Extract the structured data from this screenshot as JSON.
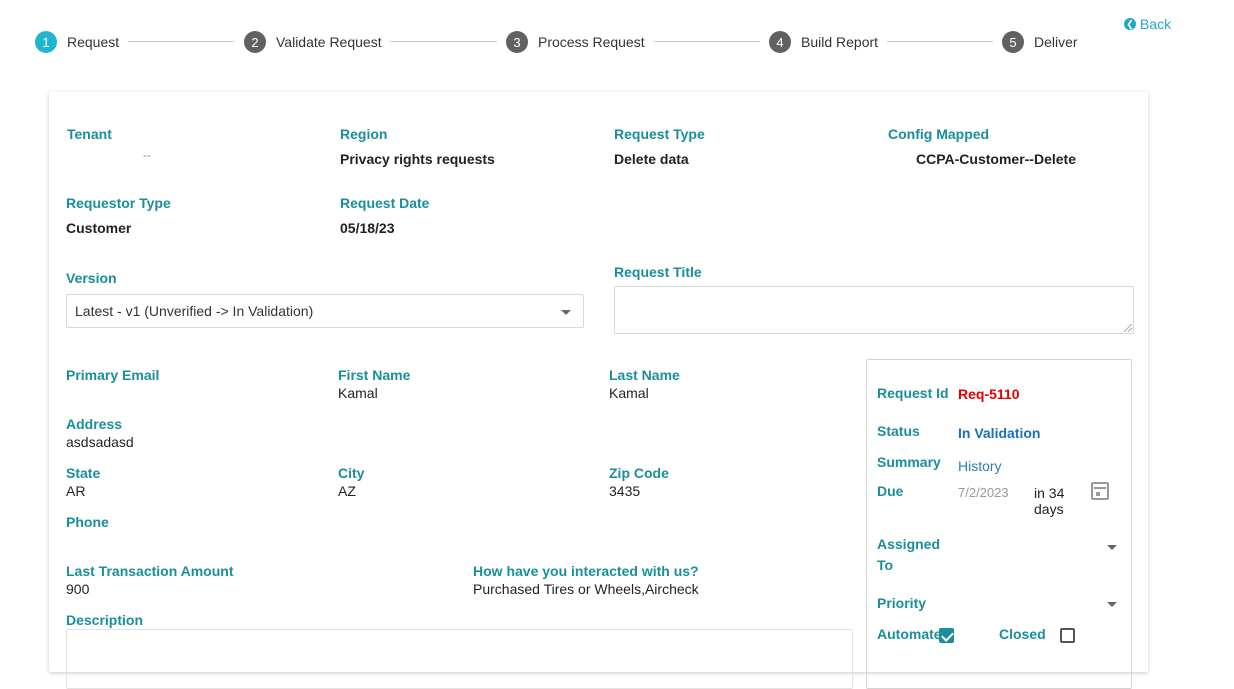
{
  "stepper": {
    "steps": [
      {
        "num": "1",
        "label": "Request"
      },
      {
        "num": "2",
        "label": "Validate Request"
      },
      {
        "num": "3",
        "label": "Process Request"
      },
      {
        "num": "4",
        "label": "Build Report"
      },
      {
        "num": "5",
        "label": "Deliver"
      }
    ],
    "active_step": 1,
    "back_label": "Back"
  },
  "header": {
    "tenant_label": "Tenant",
    "tenant_value": "--",
    "region_label": "Region",
    "region_value": "Privacy rights requests",
    "request_type_label": "Request Type",
    "request_type_value": "Delete data",
    "config_label": "Config Mapped",
    "config_value": "CCPA-Customer--Delete",
    "requestor_type_label": "Requestor Type",
    "requestor_type_value": "Customer",
    "request_date_label": "Request Date",
    "request_date_value": "05/18/23"
  },
  "version": {
    "label": "Version",
    "selected": "Latest - v1 (Unverified -> In Validation)"
  },
  "request_title": {
    "label": "Request Title",
    "value": ""
  },
  "fields": {
    "primary_email_label": "Primary Email",
    "primary_email_value": "",
    "first_name_label": "First Name",
    "first_name_value": "Kamal",
    "last_name_label": "Last Name",
    "last_name_value": "Kamal",
    "address_label": "Address",
    "address_value": "asdsadasd",
    "state_label": "State",
    "state_value": "AR",
    "city_label": "City",
    "city_value": "AZ",
    "zip_label": "Zip Code",
    "zip_value": "3435",
    "phone_label": "Phone",
    "phone_value": "",
    "last_txn_label": "Last Transaction Amount",
    "last_txn_value": "900",
    "interaction_label": "How have you interacted with us?",
    "interaction_value": "Purchased Tires or Wheels,Aircheck",
    "description_label": "Description"
  },
  "panel": {
    "request_id_label": "Request Id",
    "request_id_value": "Req-5110",
    "status_label": "Status",
    "status_value": "In Validation",
    "summary_label": "Summary",
    "summary_value": "History",
    "due_label": "Due",
    "due_date": "7/2/2023",
    "due_in_line1": "in 34",
    "due_in_line2": "days",
    "assigned_label_line1": "Assigned",
    "assigned_label_line2": "To",
    "priority_label": "Priority",
    "automated_label": "Automated",
    "automated_checked": true,
    "closed_label": "Closed",
    "closed_checked": false
  },
  "colors": {
    "accent_teal": "#1a8e9a",
    "active_step": "#20b6cf",
    "request_id_red": "#e00000",
    "status_blue": "#1a70b8"
  }
}
